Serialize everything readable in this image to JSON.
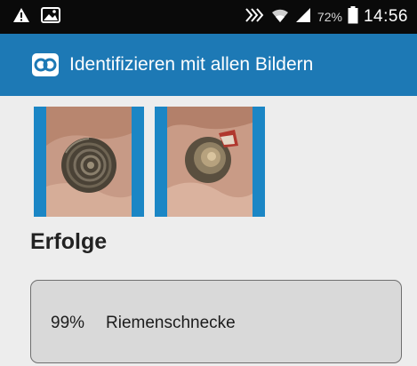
{
  "status_bar": {
    "battery_percent": "72%",
    "time": "14:56",
    "icons": [
      "warning-icon",
      "image-icon",
      "nfc-icon",
      "wifi-icon",
      "signal-icon",
      "battery-icon"
    ]
  },
  "app_bar": {
    "title": "Identifizieren mit allen Bildern",
    "icon": "app-logo-icon",
    "background": "#1d79b5"
  },
  "images": [
    {
      "name": "snail-shell-photo-1",
      "frame_color": "#1b86c5"
    },
    {
      "name": "snail-shell-photo-2",
      "frame_color": "#1b86c5"
    }
  ],
  "section": {
    "heading": "Erfolge"
  },
  "results": [
    {
      "percent": "99%",
      "species": "Riemenschnecke"
    }
  ]
}
